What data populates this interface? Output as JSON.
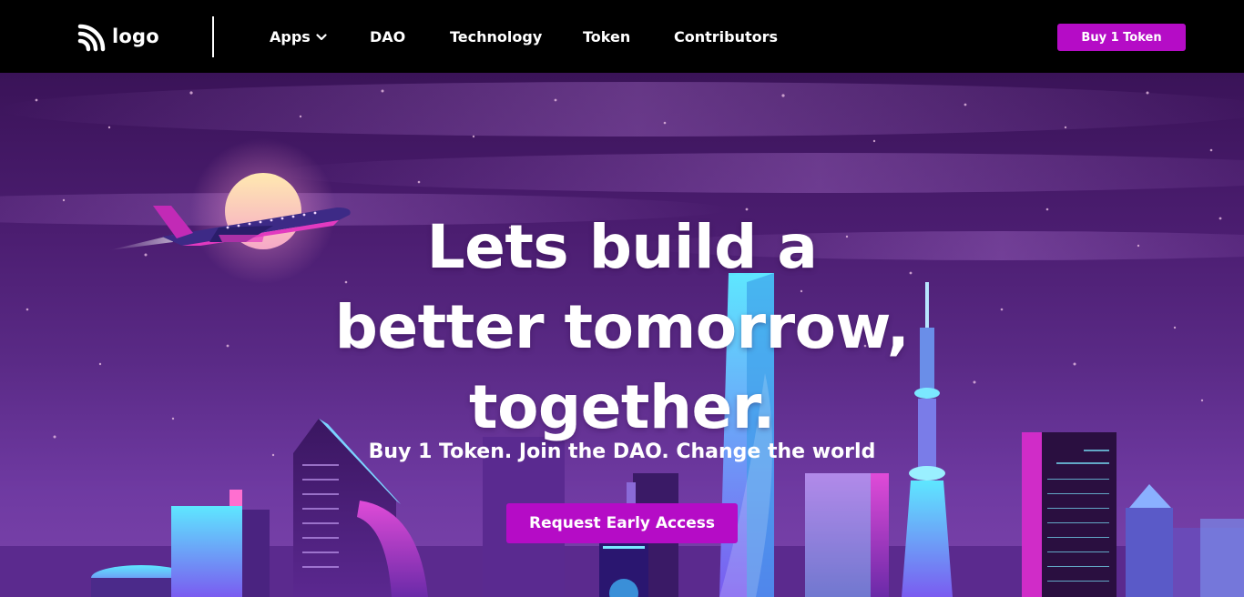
{
  "navbar": {
    "logo_text": "logo",
    "links": [
      {
        "label": "Apps",
        "has_dropdown": true
      },
      {
        "label": "DAO"
      },
      {
        "label": "Technology"
      },
      {
        "label": "Token"
      },
      {
        "label": "Contributors"
      }
    ],
    "buy_button": "Buy 1 Token"
  },
  "hero": {
    "headline": [
      "Lets build a",
      "better tomorrow,",
      "together."
    ],
    "subtitle": "Buy 1 Token. Join the DAO. Change the world",
    "cta": "Request Early Access"
  },
  "colors": {
    "accent": "#b50cc6",
    "nav_bg": "#000000",
    "sky_top": "#3a1358",
    "sky_bottom": "#7b44ab"
  },
  "icons": {
    "logo": "wifi-signal-icon",
    "dropdown": "chevron-down-icon"
  }
}
